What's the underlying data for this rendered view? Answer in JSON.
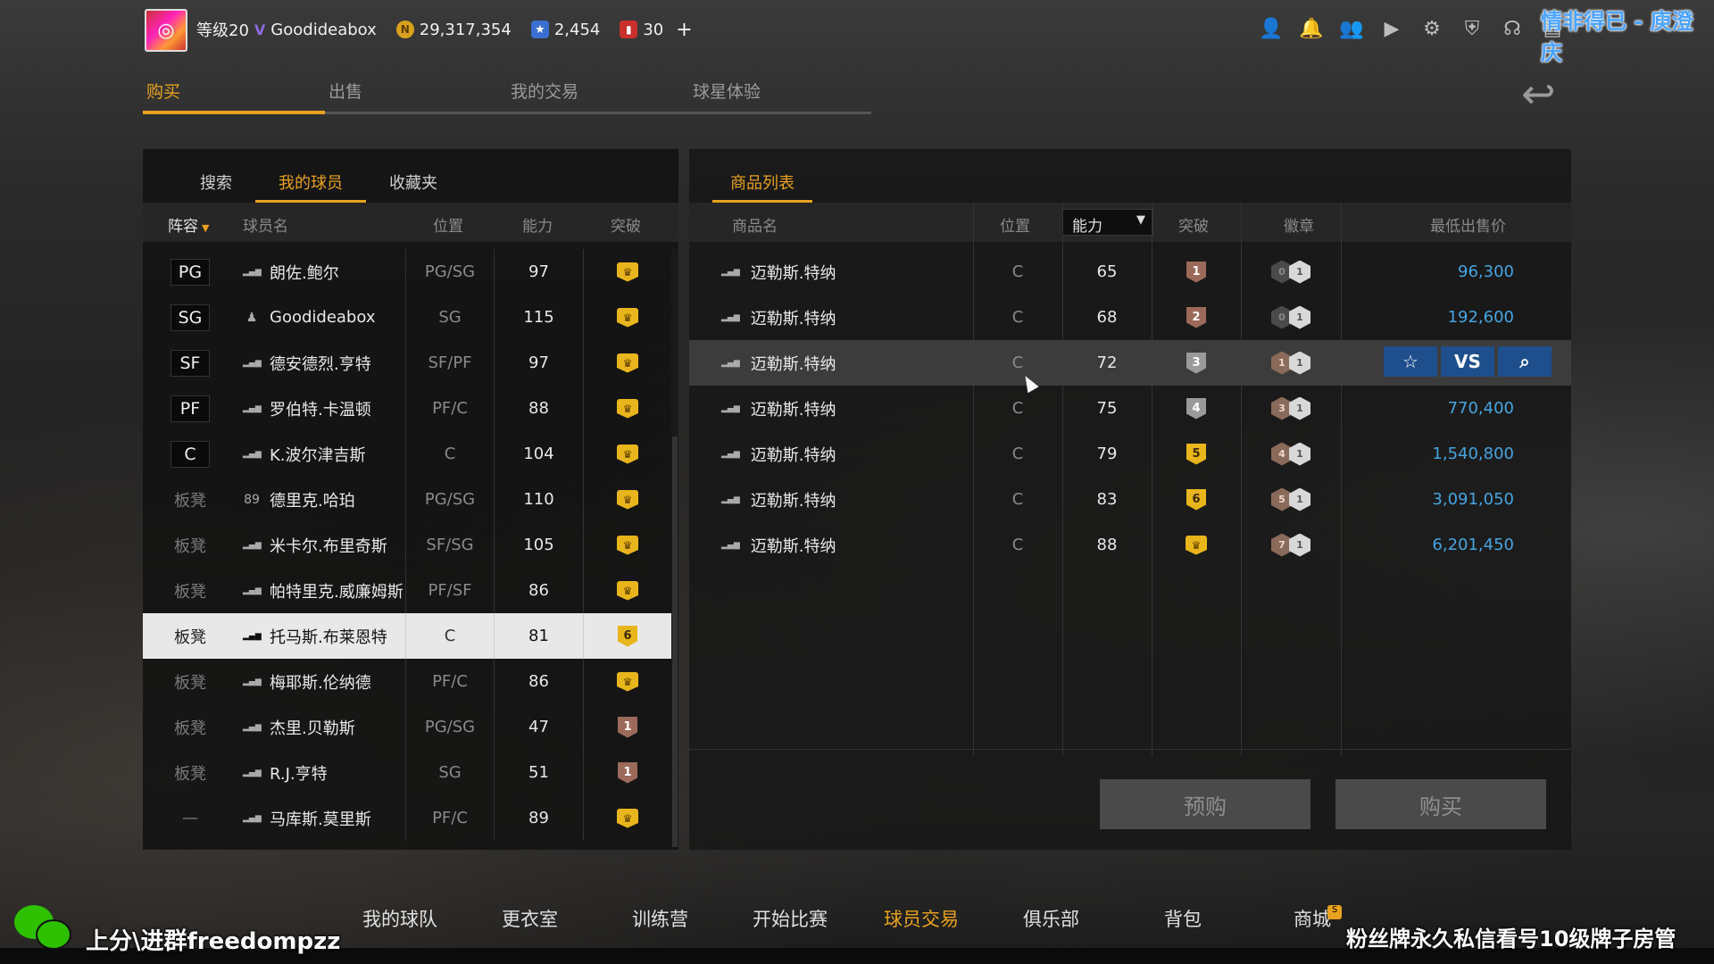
{
  "streamer_title": "情非得已 - 庾澄庆",
  "topbar": {
    "level": "等级20",
    "vip_icon": "vip-icon",
    "username": "Goodideabox",
    "coins": "29,317,354",
    "coin_icon_text": "N",
    "stars": "2,454",
    "tickets": "30",
    "plus": "+",
    "icons": [
      "profile-icon",
      "bell-icon",
      "friends-icon",
      "video-icon",
      "settings-icon",
      "shield-icon",
      "headset-icon",
      "document-icon"
    ]
  },
  "main_tabs": [
    {
      "label": "购买",
      "active": true
    },
    {
      "label": "出售",
      "active": false
    },
    {
      "label": "我的交易",
      "active": false
    },
    {
      "label": "球星体验",
      "active": false
    }
  ],
  "left_panel": {
    "tabs": [
      {
        "label": "搜索",
        "active": false
      },
      {
        "label": "我的球员",
        "active": true
      },
      {
        "label": "收藏夹",
        "active": false
      }
    ],
    "headers": {
      "lineup": "阵容",
      "name": "球员名",
      "position": "位置",
      "ability": "能力",
      "breakthrough": "突破"
    },
    "rows": [
      {
        "slot": "PG",
        "starter": true,
        "icon": "signal",
        "name": "朗佐.鲍尔",
        "pos": "PG/SG",
        "ovr": "97",
        "brk": "crown"
      },
      {
        "slot": "SG",
        "starter": true,
        "icon": "person",
        "name": "Goodideabox",
        "pos": "SG",
        "ovr": "115",
        "brk": "crown"
      },
      {
        "slot": "SF",
        "starter": true,
        "icon": "signal",
        "name": "德安德烈.亨特",
        "pos": "SF/PF",
        "ovr": "97",
        "brk": "crown"
      },
      {
        "slot": "PF",
        "starter": true,
        "icon": "signal",
        "name": "罗伯特.卡温顿",
        "pos": "PF/C",
        "ovr": "88",
        "brk": "crown"
      },
      {
        "slot": "C",
        "starter": true,
        "icon": "signal",
        "name": "K.波尔津吉斯",
        "pos": "C",
        "ovr": "104",
        "brk": "crown"
      },
      {
        "slot": "板凳",
        "starter": false,
        "icon": "89",
        "name": "德里克.哈珀",
        "pos": "PG/SG",
        "ovr": "110",
        "brk": "crown"
      },
      {
        "slot": "板凳",
        "starter": false,
        "icon": "signal",
        "name": "米卡尔.布里奇斯",
        "pos": "SF/SG",
        "ovr": "105",
        "brk": "crown"
      },
      {
        "slot": "板凳",
        "starter": false,
        "icon": "signal",
        "name": "帕特里克.威廉姆斯",
        "pos": "PF/SF",
        "ovr": "86",
        "brk": "crown"
      },
      {
        "slot": "板凳",
        "starter": false,
        "icon": "signal",
        "name": "托马斯.布莱恩特",
        "pos": "C",
        "ovr": "81",
        "brk": "6",
        "selected": true
      },
      {
        "slot": "板凳",
        "starter": false,
        "icon": "signal",
        "name": "梅耶斯.伦纳德",
        "pos": "PF/C",
        "ovr": "86",
        "brk": "crown"
      },
      {
        "slot": "板凳",
        "starter": false,
        "icon": "signal",
        "name": "杰里.贝勒斯",
        "pos": "PG/SG",
        "ovr": "47",
        "brk": "1"
      },
      {
        "slot": "板凳",
        "starter": false,
        "icon": "signal",
        "name": "R.J.亨特",
        "pos": "SG",
        "ovr": "51",
        "brk": "1"
      },
      {
        "slot": "—",
        "starter": false,
        "icon": "signal",
        "name": "马库斯.莫里斯",
        "pos": "PF/C",
        "ovr": "89",
        "brk": "crown"
      }
    ]
  },
  "right_panel": {
    "tab": "商品列表",
    "headers": {
      "name": "商品名",
      "position": "位置",
      "sort": "能力",
      "breakthrough": "突破",
      "badge": "徽章",
      "min_price": "最低出售价"
    },
    "rows": [
      {
        "name": "迈勒斯.特纳",
        "pos": "C",
        "ovr": "65",
        "brk": "1",
        "badge_a": "0",
        "badge_b": "1",
        "price": "96,300"
      },
      {
        "name": "迈勒斯.特纳",
        "pos": "C",
        "ovr": "68",
        "brk": "2",
        "badge_a": "0",
        "badge_b": "1",
        "price": "192,600"
      },
      {
        "name": "迈勒斯.特纳",
        "pos": "C",
        "ovr": "72",
        "brk": "3",
        "badge_a": "1",
        "badge_b": "1",
        "price": "",
        "hover": true
      },
      {
        "name": "迈勒斯.特纳",
        "pos": "C",
        "ovr": "75",
        "brk": "4",
        "badge_a": "3",
        "badge_b": "1",
        "price": "770,400"
      },
      {
        "name": "迈勒斯.特纳",
        "pos": "C",
        "ovr": "79",
        "brk": "5",
        "badge_a": "4",
        "badge_b": "1",
        "price": "1,540,800"
      },
      {
        "name": "迈勒斯.特纳",
        "pos": "C",
        "ovr": "83",
        "brk": "6",
        "badge_a": "5",
        "badge_b": "1",
        "price": "3,091,050"
      },
      {
        "name": "迈勒斯.特纳",
        "pos": "C",
        "ovr": "88",
        "brk": "crown",
        "badge_a": "7",
        "badge_b": "1",
        "price": "6,201,450"
      }
    ],
    "row_actions": {
      "favorite_icon": "☆",
      "vs": "VS",
      "search_icon": "⌕"
    },
    "preorder_label": "预购",
    "buy_label": "购买"
  },
  "bottom_nav": [
    {
      "label": "我的球队",
      "active": false
    },
    {
      "label": "更衣室",
      "active": false
    },
    {
      "label": "训练营",
      "active": false
    },
    {
      "label": "开始比赛",
      "active": false
    },
    {
      "label": "球员交易",
      "active": true
    },
    {
      "label": "俱乐部",
      "active": false
    },
    {
      "label": "背包",
      "active": false
    },
    {
      "label": "商城",
      "active": false
    }
  ],
  "shop_badge": "S",
  "overlay": {
    "left_text": "上分\\进群freedompzz",
    "right_text": "粉丝牌永久私信看号10级牌子房管"
  },
  "colors": {
    "accent": "#e8a21e",
    "price": "#47a4e0",
    "action_blue": "#1e4f8c",
    "brk_gold": "#e8b51c",
    "brk_low": "#9c6a5a"
  }
}
